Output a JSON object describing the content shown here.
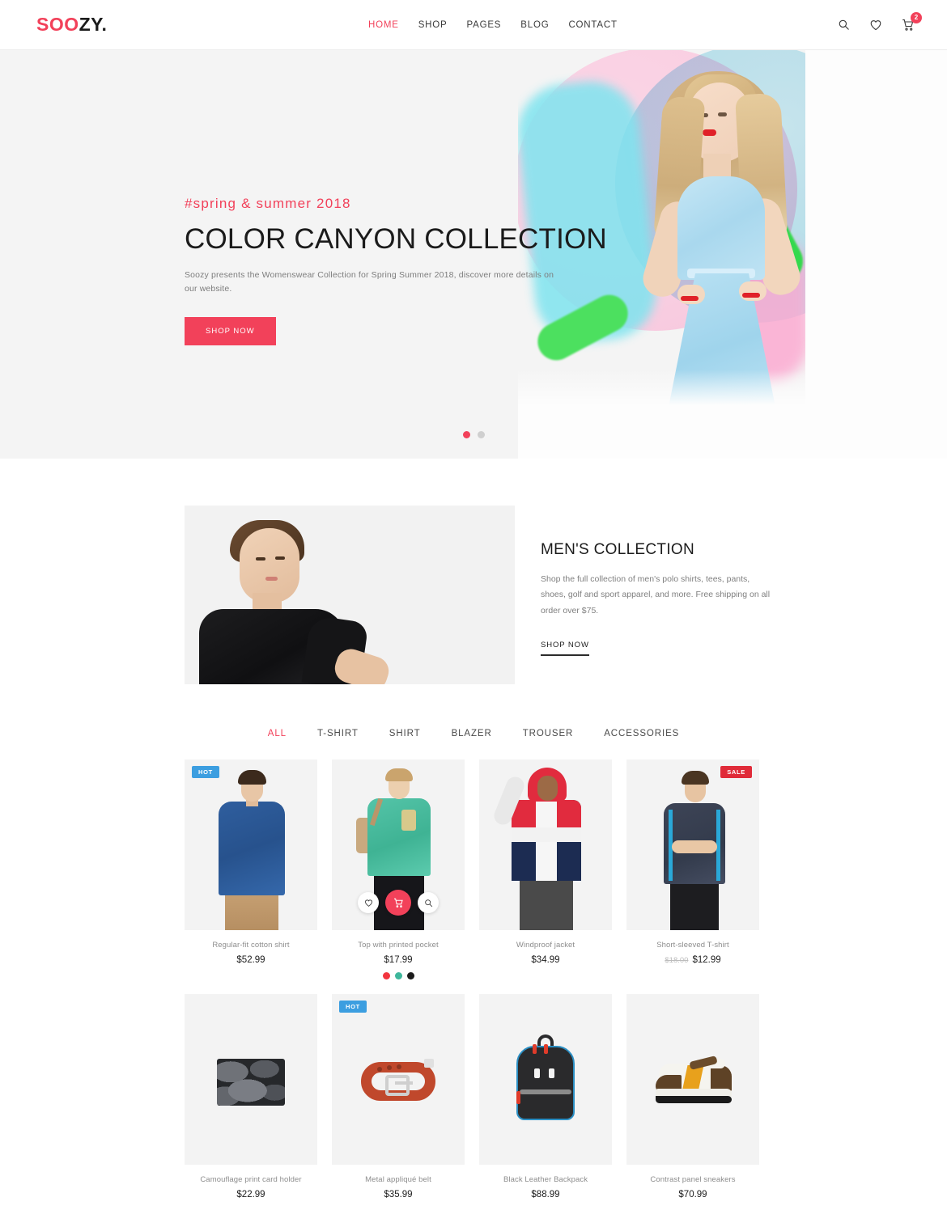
{
  "header": {
    "logo_primary": "SOO",
    "logo_secondary": "ZY.",
    "nav": [
      {
        "label": "HOME",
        "active": true
      },
      {
        "label": "SHOP",
        "active": false
      },
      {
        "label": "PAGES",
        "active": false
      },
      {
        "label": "BLOG",
        "active": false
      },
      {
        "label": "CONTACT",
        "active": false
      }
    ],
    "icons": {
      "search": "search-icon",
      "wishlist": "heart-icon",
      "cart": "cart-icon"
    },
    "cart_count": "2"
  },
  "hero": {
    "subtitle": "#spring & summer 2018",
    "title": "COLOR CANYON COLLECTION",
    "description": "Soozy presents the Womenswear Collection for Spring Summer 2018, discover more details on our website.",
    "cta": "SHOP NOW",
    "slides": 2,
    "active_slide": 1
  },
  "mens": {
    "title": "MEN'S COLLECTION",
    "description": "Shop the full collection of men's polo shirts, tees, pants, shoes, golf and sport apparel, and more. Free shipping on all order over $75.",
    "cta": "SHOP NOW"
  },
  "filters": [
    {
      "label": "ALL",
      "active": true
    },
    {
      "label": "T-SHIRT",
      "active": false
    },
    {
      "label": "SHIRT",
      "active": false
    },
    {
      "label": "BLAZER",
      "active": false
    },
    {
      "label": "TROUSER",
      "active": false
    },
    {
      "label": "ACCESSORIES",
      "active": false
    }
  ],
  "colors": {
    "accent": "#f2415a",
    "hot_badge": "#3c9ee0",
    "sale_badge": "#e02b39",
    "text_dark": "#1b1b1b",
    "text_muted": "#8d8d8d"
  },
  "actions": {
    "wishlist_label": "heart-icon",
    "cart_label": "cart-icon",
    "quickview_label": "quick-view-icon"
  },
  "products": [
    {
      "name": "Regular-fit cotton shirt",
      "price": "$52.99",
      "old_price": "",
      "badge": "HOT",
      "badge_type": "hot",
      "swatches": [],
      "art": "p1"
    },
    {
      "name": "Top with printed pocket",
      "price": "$17.99",
      "old_price": "",
      "badge": "",
      "badge_type": "",
      "swatches": [
        "#f2353f",
        "#3eb79c",
        "#1b1b1b"
      ],
      "art": "p2"
    },
    {
      "name": "Windproof jacket",
      "price": "$34.99",
      "old_price": "",
      "badge": "",
      "badge_type": "",
      "swatches": [],
      "art": "p3"
    },
    {
      "name": "Short-sleeved T-shirt",
      "price": "$12.99",
      "old_price": "$18.00",
      "badge": "SALE",
      "badge_type": "sale",
      "swatches": [],
      "art": "p4"
    },
    {
      "name": "Camouflage print card holder",
      "price": "$22.99",
      "old_price": "",
      "badge": "",
      "badge_type": "",
      "swatches": [],
      "art": "p5"
    },
    {
      "name": "Metal appliqué belt",
      "price": "$35.99",
      "old_price": "",
      "badge": "HOT",
      "badge_type": "hot",
      "swatches": [],
      "art": "p6"
    },
    {
      "name": "Black Leather Backpack",
      "price": "$88.99",
      "old_price": "",
      "badge": "",
      "badge_type": "",
      "swatches": [],
      "art": "p7"
    },
    {
      "name": "Contrast panel sneakers",
      "price": "$70.99",
      "old_price": "",
      "badge": "",
      "badge_type": "",
      "swatches": [],
      "art": "p8"
    }
  ]
}
